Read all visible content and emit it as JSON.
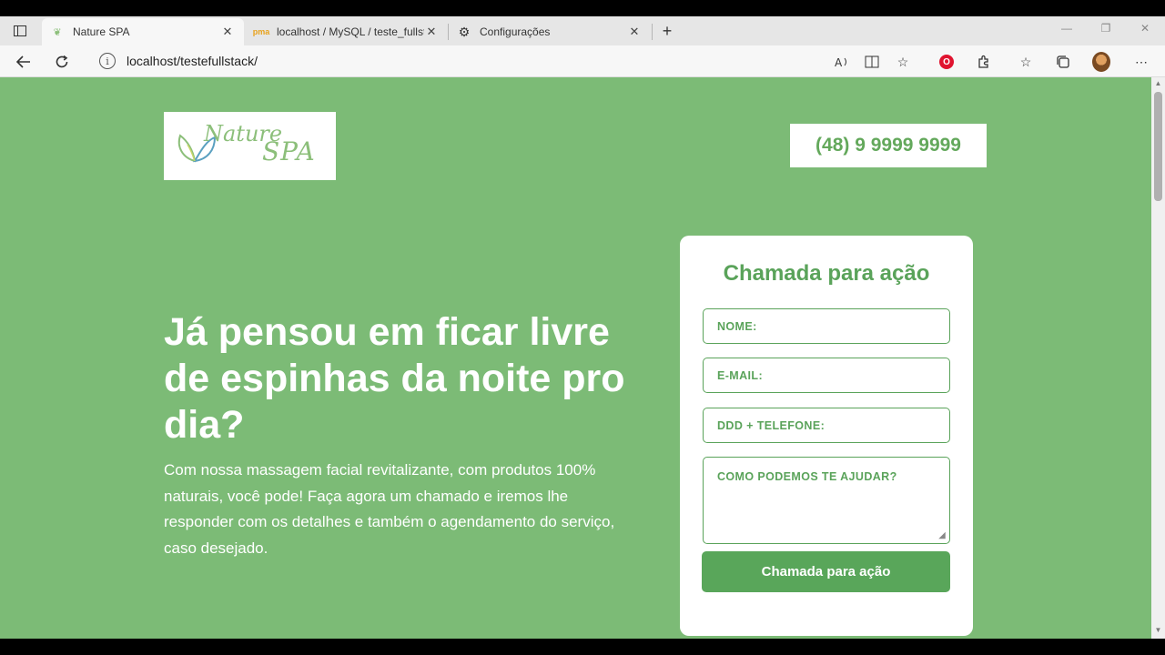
{
  "browser": {
    "tabs": [
      {
        "title": "Nature SPA",
        "active": true
      },
      {
        "title": "localhost / MySQL / teste_fullsta",
        "active": false
      },
      {
        "title": "Configurações",
        "active": false
      }
    ],
    "new_tab_label": "+",
    "url": "localhost/testefullstack/",
    "info_glyph": "i"
  },
  "page": {
    "logo": {
      "word1": "Nature",
      "word2": "SPA"
    },
    "phone": "(48) 9 9999 9999",
    "hero": {
      "title": "Já pensou em ficar livre de espinhas da noite pro dia?",
      "text": "Com nossa massagem facial revitalizante, com produtos 100% naturais, você pode! Faça agora um chamado e iremos lhe responder com os detalhes e também o agendamento do serviço, caso desejado."
    },
    "form": {
      "title": "Chamada para ação",
      "name_placeholder": "NOME:",
      "email_placeholder": "E-MAIL:",
      "phone_placeholder": "DDD + TELEFONE:",
      "message_placeholder": "COMO PODEMOS TE AJUDAR?",
      "submit_label": "Chamada para ação"
    }
  },
  "colors": {
    "page_bg": "#7cbb76",
    "accent": "#5aa35a",
    "button": "#59a65a"
  }
}
